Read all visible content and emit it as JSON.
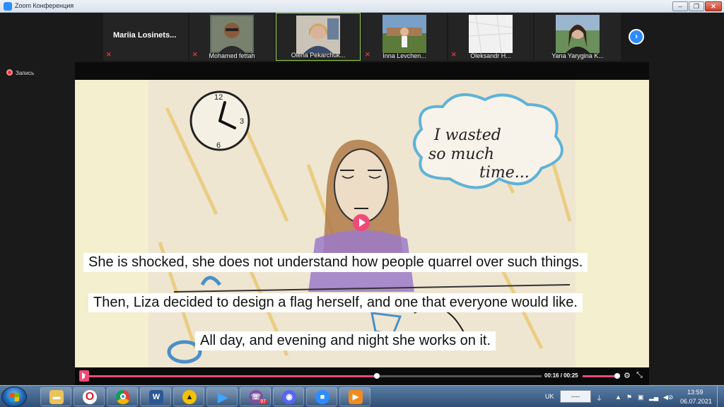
{
  "window": {
    "title": "Zoom Конференция"
  },
  "gallery": {
    "participants": [
      {
        "name": "Mariia  Losinets..."
      },
      {
        "name": "Mohamed fettah"
      },
      {
        "name": "Olena Pekarchuk..."
      },
      {
        "name": "Inna Levchen..."
      },
      {
        "name": "Oleksandr H..."
      },
      {
        "name": "Yana Yarygina K..."
      }
    ]
  },
  "recording": {
    "label": "Запись"
  },
  "video": {
    "subtitles": [
      "She is shocked, she does not understand how people quarrel over such things.",
      "Then, Liza decided to design a flag herself, and one that everyone would like.",
      "All day, and evening and night she works on it."
    ],
    "drawing_text": [
      "I wasted",
      "so much",
      "time..."
    ],
    "clock_numbers": [
      "12",
      "3",
      "6"
    ],
    "player": {
      "current_time": "00:16",
      "separator": "/",
      "duration": "00:25",
      "progress": 0.64,
      "volume": 0.9
    }
  },
  "taskbar": {
    "apps": [
      "explorer",
      "opera",
      "chrome",
      "word",
      "archiver",
      "player",
      "viber",
      "discord",
      "zoom",
      "media-player"
    ],
    "viber_badge": "97",
    "tray": {
      "language": "UK",
      "time": "13:59",
      "date": "06.07.2021",
      "input_field": "----"
    }
  },
  "colors": {
    "accent": "#2d8cff",
    "player_pink": "#f04a7a",
    "mic_off": "#e5343a"
  }
}
